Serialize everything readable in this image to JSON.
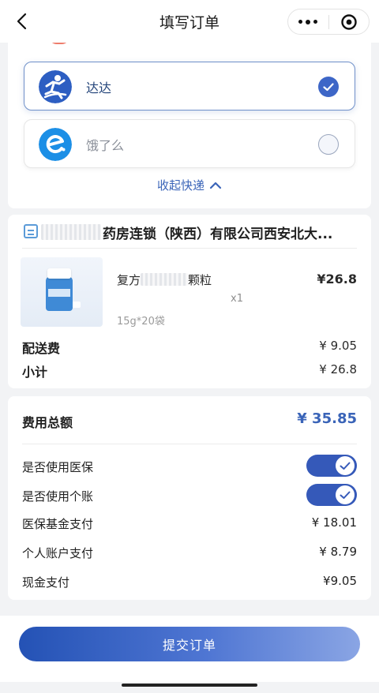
{
  "header": {
    "title": "填写订单",
    "back_icon": "chevron-left-icon",
    "more_icon": "more-dots-icon",
    "close_icon": "target-close-icon"
  },
  "delivery": {
    "options": [
      {
        "name": "达达",
        "selected": true,
        "icon": "dada-logo",
        "color": "#2d5ec2"
      },
      {
        "name": "饿了么",
        "selected": false,
        "icon": "eleme-logo",
        "color": "#1c8fe6"
      }
    ],
    "collapse_label": "收起快递"
  },
  "order": {
    "store_name": "药房连锁（陕西）有限公司西安北大...",
    "product": {
      "name_prefix": "复方",
      "name_suffix": "颗粒",
      "price": "¥26.8",
      "quantity": "x1",
      "spec": "15g*20袋"
    },
    "delivery_fee_label": "配送费",
    "delivery_fee": "¥ 9.05",
    "subtotal_label": "小计",
    "subtotal": "¥ 26.8"
  },
  "summary": {
    "total_label": "费用总额",
    "total": "¥ 35.85",
    "use_insurance_label": "是否使用医保",
    "use_insurance": true,
    "use_personal_label": "是否使用个账",
    "use_personal": true,
    "fund_label": "医保基金支付",
    "fund_value": "¥ 18.01",
    "personal_label": "个人账户支付",
    "personal_value": "¥ 8.79",
    "cash_label": "现金支付",
    "cash_value": "¥9.05"
  },
  "submit_label": "提交订单",
  "colors": {
    "accent": "#3a64b8",
    "toggle": "#3559b9"
  }
}
